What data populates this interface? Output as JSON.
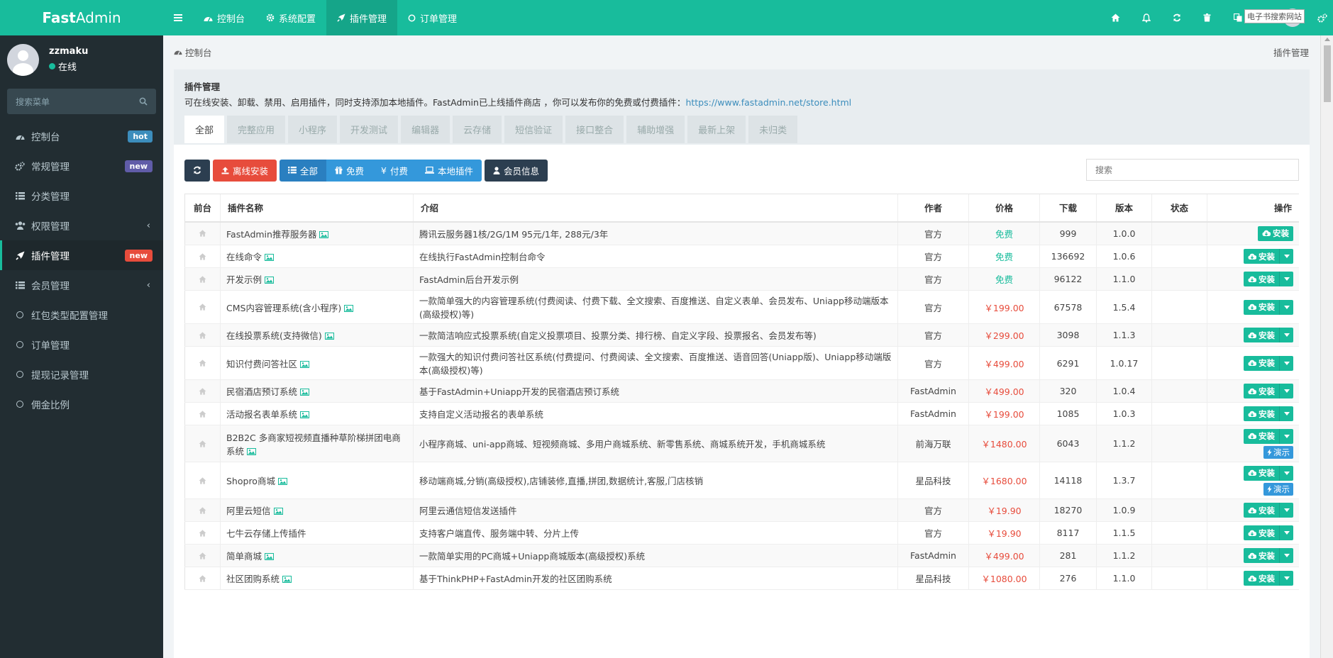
{
  "app": {
    "brand_bold": "Fast",
    "brand_rest": "Admin"
  },
  "user": {
    "name": "zzmaku",
    "status": "在线"
  },
  "sidebar": {
    "search_placeholder": "搜索菜单",
    "items": [
      {
        "label": "控制台",
        "icon": "dashboard-icon",
        "badge": "hot",
        "badge_color": "#3c8dbc"
      },
      {
        "label": "常规管理",
        "icon": "cogs-icon",
        "badge": "new",
        "badge_color": "#605ca8"
      },
      {
        "label": "分类管理",
        "icon": "list-icon"
      },
      {
        "label": "权限管理",
        "icon": "group-icon",
        "chevron": "‹"
      },
      {
        "label": "插件管理",
        "icon": "rocket-icon",
        "badge": "new",
        "badge_color": "#e74c3c",
        "active": true
      },
      {
        "label": "会员管理",
        "icon": "list-icon",
        "chevron": "‹"
      },
      {
        "label": "红包类型配置管理",
        "icon": "circle-icon"
      },
      {
        "label": "订单管理",
        "icon": "circle-icon"
      },
      {
        "label": "提现记录管理",
        "icon": "circle-icon"
      },
      {
        "label": "佣金比例",
        "icon": "circle-icon"
      }
    ]
  },
  "topnav": {
    "tabs": [
      {
        "label": "控制台",
        "icon": "dashboard-icon"
      },
      {
        "label": "系统配置",
        "icon": "cog-icon"
      },
      {
        "label": "插件管理",
        "icon": "rocket-icon",
        "active": true
      },
      {
        "label": "订单管理",
        "icon": "circle-icon"
      }
    ],
    "watermark": "电子书搜索网站"
  },
  "breadcrumb": {
    "left": "控制台",
    "right": "插件管理"
  },
  "panel": {
    "title": "插件管理",
    "description": "可在线安装、卸载、禁用、启用插件，同时支持添加本地插件。FastAdmin已上线插件商店 ，你可以发布你的免费或付费插件：",
    "link": "https://www.fastadmin.net/store.html",
    "tabs": [
      "全部",
      "完整应用",
      "小程序",
      "开发测试",
      "编辑器",
      "云存储",
      "短信验证",
      "接口整合",
      "辅助增强",
      "最新上架",
      "未归类"
    ]
  },
  "toolbar": {
    "offline_install": "离线安装",
    "filter_all": "全部",
    "filter_free": "免费",
    "filter_paid": "付费",
    "filter_local": "本地插件",
    "member_info": "会员信息",
    "search_placeholder": "搜索"
  },
  "table": {
    "headers": {
      "front": "前台",
      "name": "插件名称",
      "intro": "介绍",
      "author": "作者",
      "price": "价格",
      "downloads": "下载",
      "version": "版本",
      "status": "状态",
      "ops": "操作"
    },
    "install_label": "安装",
    "demo_label": "演示",
    "rows": [
      {
        "name": "FastAdmin推荐服务器",
        "intro": "腾讯云服务器1核/2G/1M 95元/1年, 288元/3年",
        "author": "官方",
        "price": "免费",
        "free": true,
        "downloads": "999",
        "version": "1.0.0",
        "dropdown": false
      },
      {
        "name": "在线命令",
        "intro": "在线执行FastAdmin控制台命令",
        "author": "官方",
        "price": "免费",
        "free": true,
        "downloads": "136692",
        "version": "1.0.6",
        "dropdown": true
      },
      {
        "name": "开发示例",
        "intro": "FastAdmin后台开发示例",
        "author": "官方",
        "price": "免费",
        "free": true,
        "downloads": "96122",
        "version": "1.1.0",
        "dropdown": true
      },
      {
        "name": "CMS内容管理系统(含小程序)",
        "intro": "一款简单强大的内容管理系统(付费阅读、付费下载、全文搜索、百度推送、自定义表单、会员发布、Uniapp移动端版本(高级授权)等)",
        "author": "官方",
        "price": "￥199.00",
        "free": false,
        "downloads": "67578",
        "version": "1.5.4",
        "dropdown": true
      },
      {
        "name": "在线投票系统(支持微信)",
        "intro": "一款简洁响应式投票系统(自定义投票项目、投票分类、排行榜、自定义字段、投票报名、会员发布等)",
        "author": "官方",
        "price": "￥299.00",
        "free": false,
        "downloads": "3098",
        "version": "1.1.3",
        "dropdown": true
      },
      {
        "name": "知识付费问答社区",
        "intro": "一款强大的知识付费问答社区系统(付费提问、付费阅读、全文搜索、百度推送、语音回答(Uniapp版)、Uniapp移动端版本(高级授权)等)",
        "author": "官方",
        "price": "￥499.00",
        "free": false,
        "downloads": "6291",
        "version": "1.0.17",
        "dropdown": true
      },
      {
        "name": "民宿酒店预订系统",
        "intro": "基于FastAdmin+Uniapp开发的民宿酒店预订系统",
        "author": "FastAdmin",
        "price": "￥499.00",
        "free": false,
        "downloads": "320",
        "version": "1.0.4",
        "dropdown": true
      },
      {
        "name": "活动报名表单系统",
        "intro": "支持自定义活动报名的表单系统",
        "author": "FastAdmin",
        "price": "￥199.00",
        "free": false,
        "downloads": "1085",
        "version": "1.0.3",
        "dropdown": true
      },
      {
        "name": "B2B2C 多商家短视频直播种草阶梯拼团电商系统",
        "intro": "小程序商城、uni-app商城、短视频商城、多用户商城系统、新零售系统、商城系统开发，手机商城系统",
        "author": "前海万联",
        "price": "￥1480.00",
        "free": false,
        "downloads": "6043",
        "version": "1.1.2",
        "dropdown": true,
        "demo": true
      },
      {
        "name": "Shopro商城",
        "intro": "移动端商城,分销(高级授权),店铺装修,直播,拼团,数据统计,客服,门店核销",
        "author": "星品科技",
        "price": "￥1680.00",
        "free": false,
        "downloads": "14118",
        "version": "1.3.7",
        "dropdown": true,
        "demo": true
      },
      {
        "name": "阿里云短信",
        "intro": "阿里云通信短信发送插件",
        "author": "官方",
        "price": "￥19.90",
        "free": false,
        "downloads": "18270",
        "version": "1.0.9",
        "dropdown": true
      },
      {
        "name": "七牛云存储上传插件",
        "intro": "支持客户端直传、服务端中转、分片上传",
        "author": "官方",
        "price": "￥19.90",
        "free": false,
        "downloads": "8117",
        "version": "1.1.5",
        "dropdown": true,
        "noimg": true
      },
      {
        "name": "简单商城",
        "intro": "一款简单实用的PC商城+Uniapp商城版本(高级授权)系统",
        "author": "FastAdmin",
        "price": "￥499.00",
        "free": false,
        "downloads": "281",
        "version": "1.1.2",
        "dropdown": true
      },
      {
        "name": "社区团购系统",
        "intro": "基于ThinkPHP+FastAdmin开发的社区团购系统",
        "author": "星品科技",
        "price": "￥1080.00",
        "free": false,
        "downloads": "276",
        "version": "1.1.0",
        "dropdown": true
      }
    ]
  },
  "colors": {
    "primary": "#18bc9c",
    "sidebar_bg": "#222d32",
    "danger": "#e74c3c",
    "info": "#3498db",
    "dark": "#2c3e50"
  }
}
